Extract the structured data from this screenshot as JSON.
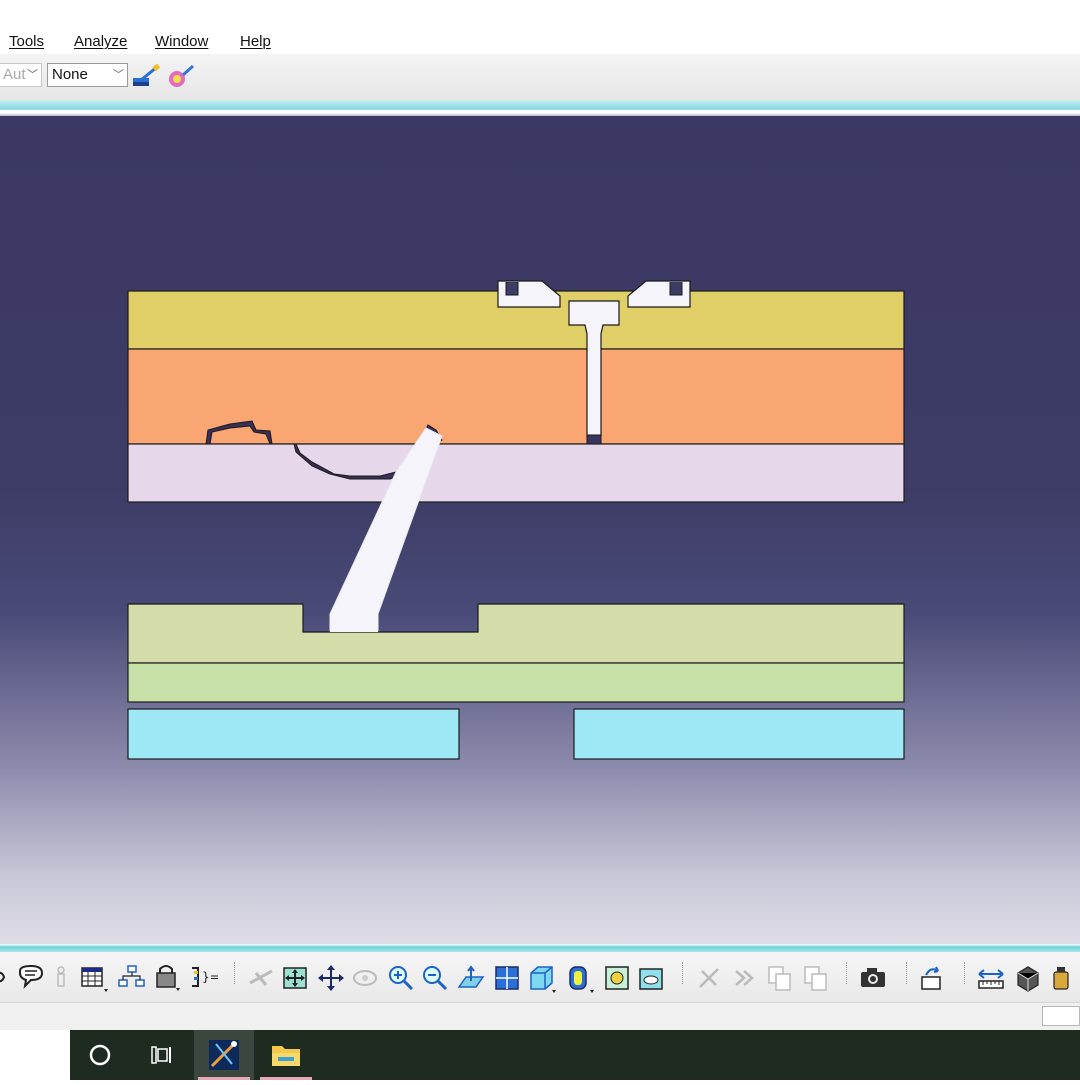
{
  "menubar": {
    "items": [
      {
        "label": "Tools"
      },
      {
        "label": "Analyze"
      },
      {
        "label": "Window"
      },
      {
        "label": "Help"
      }
    ]
  },
  "toolbar_top": {
    "combo_auto": {
      "value": "Aut",
      "disabled": true
    },
    "combo_none": {
      "value": "None"
    },
    "icons": [
      "paint-brush-icon",
      "color-sphere-icon"
    ]
  },
  "viewport": {
    "background_top": "#3b3963",
    "background_bottom": "#dedde6",
    "layer_colors": {
      "top_plate": "#e0cf66",
      "cavity_plate": "#f9a672",
      "core_plate": "#e6d8ea",
      "ejector_plate": "#d4dcaa",
      "support_plate": "#c6e0a8",
      "spacer_blocks": "#9de8f4",
      "sprue_and_lifter": "#f4f4fa",
      "part": "#3a2f58"
    }
  },
  "toolbar_bottom": {
    "icons": [
      "speech-bubble-icon",
      "dimmed-figure-icon",
      "grid-table-icon",
      "tree-graph-icon",
      "lock-cube-icon",
      "formula-list-icon",
      "fly-mode-icon",
      "fit-all-icon",
      "pan-icon",
      "rotate-icon",
      "zoom-in-icon",
      "zoom-out-icon",
      "normal-view-icon",
      "multi-view-icon",
      "iso-view-icon",
      "shading-icon",
      "hide-show-icon",
      "swap-space-icon",
      "cut-icon",
      "next-icon",
      "copy-icon",
      "paste-icon",
      "camera-icon",
      "save-view-icon",
      "measure-icon",
      "inertia-icon",
      "weight-icon"
    ]
  },
  "taskbar": {
    "items": [
      "cortana-circle-icon",
      "task-view-icon",
      "catia-app-icon",
      "file-explorer-icon"
    ]
  }
}
